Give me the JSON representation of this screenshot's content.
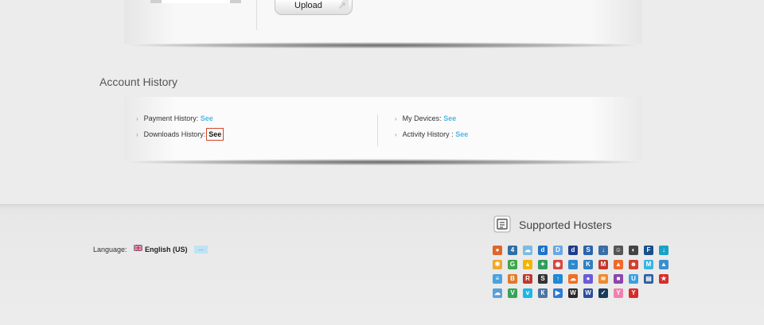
{
  "upload": {
    "label": "Upload"
  },
  "account_history": {
    "title": "Account History",
    "left_items": [
      {
        "label": "Payment History:",
        "link": "See"
      },
      {
        "label": "Downloads History:",
        "link": "See"
      }
    ],
    "right_items": [
      {
        "label": "My Devices:",
        "link": "See"
      },
      {
        "label": "Activity History :",
        "link": "See"
      }
    ]
  },
  "footer": {
    "language_label": "Language:",
    "language_value": "English (US)",
    "language_more": "...",
    "hosters_title": "Supported Hosters",
    "hosters": [
      {
        "icon": "fruit-icon",
        "color": "#e0662a",
        "glyph": "●"
      },
      {
        "icon": "four-icon",
        "color": "#2f6fa8",
        "glyph": "4"
      },
      {
        "icon": "cloud-icon",
        "color": "#7bbbe0",
        "glyph": "☁"
      },
      {
        "icon": "d-dark-icon",
        "color": "#1f73c9",
        "glyph": "d"
      },
      {
        "icon": "d-light-icon",
        "color": "#6aa7e3",
        "glyph": "D"
      },
      {
        "icon": "d-navy-icon",
        "color": "#1c3f8a",
        "glyph": "d"
      },
      {
        "icon": "swirl-icon",
        "color": "#2a65ad",
        "glyph": "S"
      },
      {
        "icon": "download-icon",
        "color": "#3a6ea5",
        "glyph": "↓"
      },
      {
        "icon": "face-icon",
        "color": "#555555",
        "glyph": "☺"
      },
      {
        "icon": "disc-icon",
        "color": "#444444",
        "glyph": "◐"
      },
      {
        "icon": "fireload-icon",
        "color": "#1a4f8c",
        "glyph": "F"
      },
      {
        "icon": "down-arrow-icon",
        "color": "#19a2c6",
        "glyph": "↓"
      },
      {
        "icon": "gear-icon",
        "color": "#f0a82a",
        "glyph": "✱"
      },
      {
        "icon": "g-icon",
        "color": "#3fa64a",
        "glyph": "G"
      },
      {
        "icon": "drive-icon",
        "color": "#f4b400",
        "glyph": "▲"
      },
      {
        "icon": "star-arrows-icon",
        "color": "#2e9e5b",
        "glyph": "✦"
      },
      {
        "icon": "chrome-icon",
        "color": "#d9453b",
        "glyph": "◉"
      },
      {
        "icon": "wave-icon",
        "color": "#2b8bd0",
        "glyph": "~"
      },
      {
        "icon": "k-icon",
        "color": "#2f7fc1",
        "glyph": "K"
      },
      {
        "icon": "mega-icon",
        "color": "#c0392b",
        "glyph": "M"
      },
      {
        "icon": "flame-icon",
        "color": "#f06a2a",
        "glyph": "▲"
      },
      {
        "icon": "skull-icon",
        "color": "#d04030",
        "glyph": "☻"
      },
      {
        "icon": "m-icon",
        "color": "#37b6e6",
        "glyph": "M"
      },
      {
        "icon": "boat-icon",
        "color": "#3a8fd0",
        "glyph": "▲"
      },
      {
        "icon": "net-icon",
        "color": "#4aa3df",
        "glyph": "≡"
      },
      {
        "icon": "book-icon",
        "color": "#e07b2a",
        "glyph": "B"
      },
      {
        "icon": "r-icon",
        "color": "#c0392b",
        "glyph": "R"
      },
      {
        "icon": "s-icon",
        "color": "#333333",
        "glyph": "S"
      },
      {
        "icon": "upload-arrow-icon",
        "color": "#1e88d6",
        "glyph": "↑"
      },
      {
        "icon": "soundcloud-icon",
        "color": "#f26f23",
        "glyph": "☁"
      },
      {
        "icon": "orb-icon",
        "color": "#6b5bd6",
        "glyph": "●"
      },
      {
        "icon": "layers-icon",
        "color": "#f08a2a",
        "glyph": "≋"
      },
      {
        "icon": "gift-icon",
        "color": "#8e44ad",
        "glyph": "■"
      },
      {
        "icon": "u-icon",
        "color": "#3aa0e0",
        "glyph": "U"
      },
      {
        "icon": "film-icon",
        "color": "#2c5e9e",
        "glyph": "▤"
      },
      {
        "icon": "star-icon",
        "color": "#d62c2c",
        "glyph": "★"
      },
      {
        "icon": "cloud-up-icon",
        "color": "#5aa0d8",
        "glyph": "☁"
      },
      {
        "icon": "v-green-icon",
        "color": "#3aa35a",
        "glyph": "V"
      },
      {
        "icon": "vimeo-icon",
        "color": "#1ab7ea",
        "glyph": "v"
      },
      {
        "icon": "vk-icon",
        "color": "#4c75a3",
        "glyph": "К"
      },
      {
        "icon": "play-icon",
        "color": "#2b7bd0",
        "glyph": "▶"
      },
      {
        "icon": "w-dark-icon",
        "color": "#2b2b2b",
        "glyph": "W"
      },
      {
        "icon": "w-blue-icon",
        "color": "#2a4f9e",
        "glyph": "W"
      },
      {
        "icon": "check-icon",
        "color": "#1a3a5a",
        "glyph": "✓"
      },
      {
        "icon": "yp-icon",
        "color": "#f080b0",
        "glyph": "Y"
      },
      {
        "icon": "youtube-icon",
        "color": "#d92b2b",
        "glyph": "Y"
      }
    ]
  }
}
